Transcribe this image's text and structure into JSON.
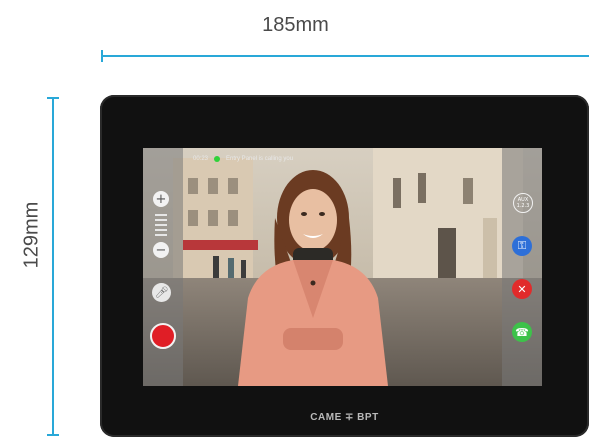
{
  "dimensions": {
    "width_label": "185mm",
    "height_label": "129mm"
  },
  "device": {
    "brand": "CAME ∓ BPT",
    "status": {
      "time": "00:23",
      "message": "Entry Panel is calling you"
    },
    "left_controls": {
      "zoom_in_label": "+",
      "zoom_out_label": "−",
      "mic_icon": "microphone-icon",
      "record_icon": "record-icon"
    },
    "right_controls": {
      "aux_label": "AUX",
      "aux_sub": "1.2.3",
      "key_icon": "key-icon",
      "hangup_icon": "hangup-icon",
      "answer_icon": "answer-icon"
    },
    "colors": {
      "accent_blue": "#29a8d8",
      "record_red": "#e01e26",
      "hangup_red": "#e12b2b",
      "answer_green": "#3dc24a",
      "key_blue": "#2d6fd8",
      "status_green": "#2fd23a"
    }
  }
}
